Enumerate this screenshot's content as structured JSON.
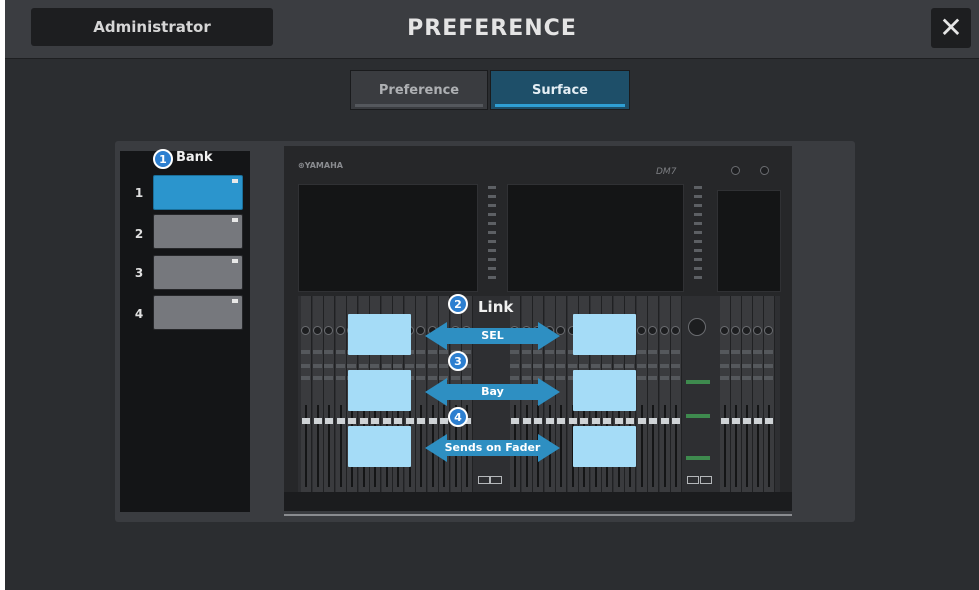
{
  "header": {
    "user_label": "Administrator",
    "title": "PREFERENCE",
    "close_glyph": "✕",
    "close_icon": "close-icon"
  },
  "tabs": [
    {
      "label": "Preference",
      "active": false
    },
    {
      "label": "Surface",
      "active": true
    }
  ],
  "bank": {
    "title": "Bank",
    "badge": "1",
    "buttons": [
      {
        "number": "1",
        "active": true
      },
      {
        "number": "2",
        "active": false
      },
      {
        "number": "3",
        "active": false
      },
      {
        "number": "4",
        "active": false
      }
    ]
  },
  "console": {
    "brand": "⊛YAMAHA",
    "model": "DM7"
  },
  "link": {
    "title": "Link",
    "badge": "2",
    "items": [
      {
        "badge": "2",
        "label": "SEL"
      },
      {
        "badge": "3",
        "label": "Bay"
      },
      {
        "badge": "4",
        "label": "Sends on Fader"
      }
    ]
  },
  "colors": {
    "accent": "#2b95cd",
    "highlight_region": "#a5dcf7",
    "badge": "#2d7fd0",
    "arrow": "#2e8fc2"
  }
}
